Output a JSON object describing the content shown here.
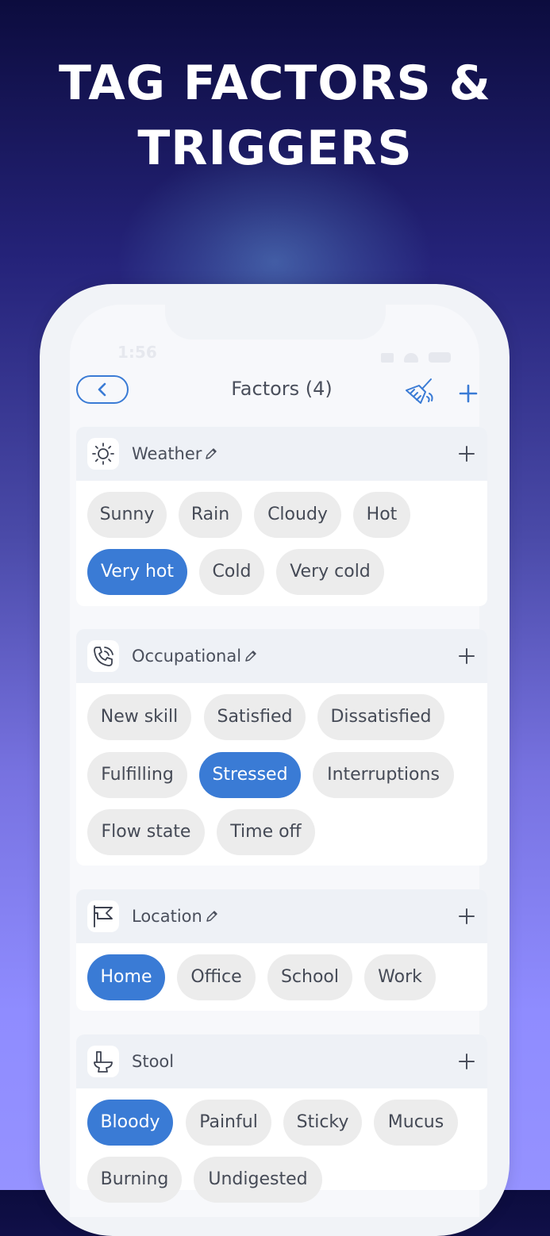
{
  "headline": {
    "line1": "TAG FACTORS &",
    "line2": "TRIGGERS"
  },
  "status_bar": {
    "time": "1:56"
  },
  "header": {
    "title": "Factors (4)"
  },
  "accent_color": "#3a7bd5",
  "categories": [
    {
      "name": "Weather",
      "icon": "sun-icon",
      "editable": true,
      "chips": [
        {
          "label": "Sunny",
          "selected": false
        },
        {
          "label": "Rain",
          "selected": false
        },
        {
          "label": "Cloudy",
          "selected": false
        },
        {
          "label": "Hot",
          "selected": false
        },
        {
          "label": "Very hot",
          "selected": true
        },
        {
          "label": "Cold",
          "selected": false
        },
        {
          "label": "Very cold",
          "selected": false
        }
      ]
    },
    {
      "name": "Occupational",
      "icon": "phone-icon",
      "editable": true,
      "chips": [
        {
          "label": "New skill",
          "selected": false
        },
        {
          "label": "Satisfied",
          "selected": false
        },
        {
          "label": "Dissatisfied",
          "selected": false
        },
        {
          "label": "Fulfilling",
          "selected": false
        },
        {
          "label": "Stressed",
          "selected": true
        },
        {
          "label": "Interruptions",
          "selected": false
        },
        {
          "label": "Flow state",
          "selected": false
        },
        {
          "label": "Time off",
          "selected": false
        }
      ]
    },
    {
      "name": "Location",
      "icon": "flag-icon",
      "editable": true,
      "chips": [
        {
          "label": "Home",
          "selected": true
        },
        {
          "label": "Office",
          "selected": false
        },
        {
          "label": "School",
          "selected": false
        },
        {
          "label": "Work",
          "selected": false
        }
      ]
    },
    {
      "name": "Stool",
      "icon": "toilet-icon",
      "editable": false,
      "chips": [
        {
          "label": "Bloody",
          "selected": true
        },
        {
          "label": "Painful",
          "selected": false
        },
        {
          "label": "Sticky",
          "selected": false
        },
        {
          "label": "Mucus",
          "selected": false
        },
        {
          "label": "Burning",
          "selected": false
        },
        {
          "label": "Undigested",
          "selected": false
        }
      ]
    }
  ]
}
